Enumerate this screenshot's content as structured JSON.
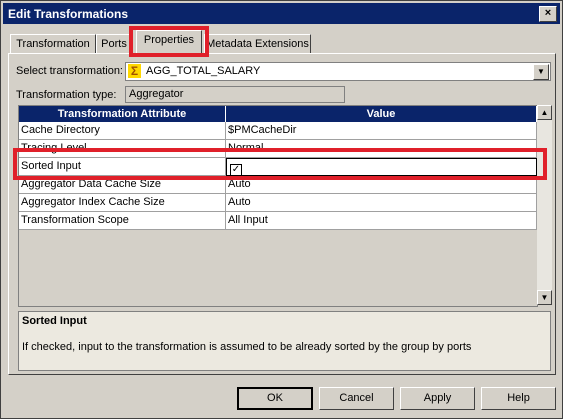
{
  "window": {
    "title": "Edit Transformations",
    "close_glyph": "×"
  },
  "tabs": [
    {
      "label": "Transformation"
    },
    {
      "label": "Ports"
    },
    {
      "label": "Properties"
    },
    {
      "label": "Metadata Extensions"
    }
  ],
  "select_transformation": {
    "label": "Select transformation:",
    "value": "AGG_TOTAL_SALARY",
    "icon": "sigma-icon",
    "icon_glyph": "Σ"
  },
  "transformation_type": {
    "label": "Transformation type:",
    "value": "Aggregator"
  },
  "grid": {
    "headers": [
      "Transformation Attribute",
      "Value"
    ],
    "rows": [
      {
        "attr": "Cache Directory",
        "value": "$PMCacheDir"
      },
      {
        "attr": "Tracing Level",
        "value": "Normal"
      },
      {
        "attr": "Sorted Input",
        "value": "",
        "checked": true
      },
      {
        "attr": "Aggregator Data Cache Size",
        "value": "Auto"
      },
      {
        "attr": "Aggregator Index Cache Size",
        "value": "Auto"
      },
      {
        "attr": "Transformation Scope",
        "value": "All Input"
      }
    ]
  },
  "description": {
    "title": "Sorted Input",
    "text": "If checked, input to the transformation is assumed to be already sorted by the group by ports"
  },
  "buttons": {
    "ok": "OK",
    "cancel": "Cancel",
    "apply": "Apply",
    "help": "Help"
  },
  "colors": {
    "titlebar": "#0a246a",
    "highlight": "#e0202a",
    "face": "#d4d0c8"
  }
}
